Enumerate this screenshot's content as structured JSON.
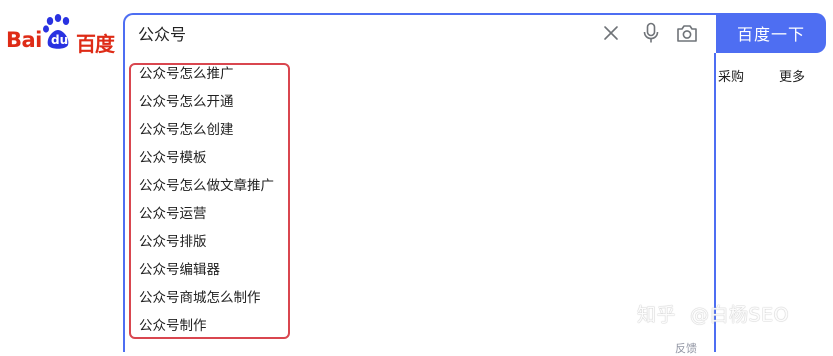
{
  "logo": {
    "latin": "Bai",
    "du": "du",
    "chinese": "百度"
  },
  "search": {
    "query": "公众号",
    "placeholder": ""
  },
  "search_button_label": "百度一下",
  "nav": {
    "purchase": "采购",
    "more": "更多"
  },
  "suggestions": [
    "公众号怎么推广",
    "公众号怎么开通",
    "公众号怎么创建",
    "公众号模板",
    "公众号怎么做文章推广",
    "公众号运营",
    "公众号排版",
    "公众号编辑器",
    "公众号商城怎么制作",
    "公众号制作"
  ],
  "feedback_label": "反馈",
  "watermark": {
    "site": "知乎",
    "author": "@白杨SEO"
  },
  "colors": {
    "brand_red": "#de2b16",
    "accent_blue": "#4e6ef2",
    "highlight_red": "#d9464f"
  }
}
